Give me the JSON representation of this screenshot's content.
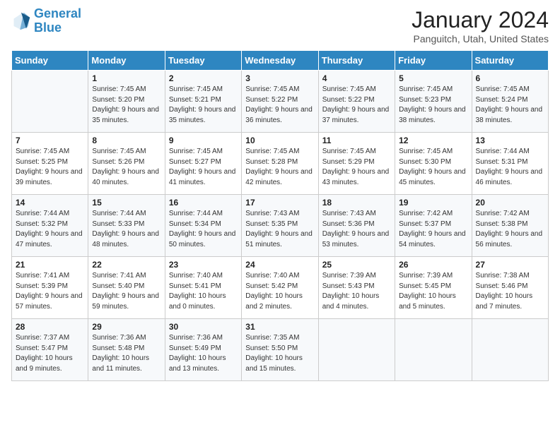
{
  "logo": {
    "line1": "General",
    "line2": "Blue"
  },
  "title": "January 2024",
  "subtitle": "Panguitch, Utah, United States",
  "weekdays": [
    "Sunday",
    "Monday",
    "Tuesday",
    "Wednesday",
    "Thursday",
    "Friday",
    "Saturday"
  ],
  "weeks": [
    [
      {
        "num": "",
        "sunrise": "",
        "sunset": "",
        "daylight": ""
      },
      {
        "num": "1",
        "sunrise": "Sunrise: 7:45 AM",
        "sunset": "Sunset: 5:20 PM",
        "daylight": "Daylight: 9 hours and 35 minutes."
      },
      {
        "num": "2",
        "sunrise": "Sunrise: 7:45 AM",
        "sunset": "Sunset: 5:21 PM",
        "daylight": "Daylight: 9 hours and 35 minutes."
      },
      {
        "num": "3",
        "sunrise": "Sunrise: 7:45 AM",
        "sunset": "Sunset: 5:22 PM",
        "daylight": "Daylight: 9 hours and 36 minutes."
      },
      {
        "num": "4",
        "sunrise": "Sunrise: 7:45 AM",
        "sunset": "Sunset: 5:22 PM",
        "daylight": "Daylight: 9 hours and 37 minutes."
      },
      {
        "num": "5",
        "sunrise": "Sunrise: 7:45 AM",
        "sunset": "Sunset: 5:23 PM",
        "daylight": "Daylight: 9 hours and 38 minutes."
      },
      {
        "num": "6",
        "sunrise": "Sunrise: 7:45 AM",
        "sunset": "Sunset: 5:24 PM",
        "daylight": "Daylight: 9 hours and 38 minutes."
      }
    ],
    [
      {
        "num": "7",
        "sunrise": "Sunrise: 7:45 AM",
        "sunset": "Sunset: 5:25 PM",
        "daylight": "Daylight: 9 hours and 39 minutes."
      },
      {
        "num": "8",
        "sunrise": "Sunrise: 7:45 AM",
        "sunset": "Sunset: 5:26 PM",
        "daylight": "Daylight: 9 hours and 40 minutes."
      },
      {
        "num": "9",
        "sunrise": "Sunrise: 7:45 AM",
        "sunset": "Sunset: 5:27 PM",
        "daylight": "Daylight: 9 hours and 41 minutes."
      },
      {
        "num": "10",
        "sunrise": "Sunrise: 7:45 AM",
        "sunset": "Sunset: 5:28 PM",
        "daylight": "Daylight: 9 hours and 42 minutes."
      },
      {
        "num": "11",
        "sunrise": "Sunrise: 7:45 AM",
        "sunset": "Sunset: 5:29 PM",
        "daylight": "Daylight: 9 hours and 43 minutes."
      },
      {
        "num": "12",
        "sunrise": "Sunrise: 7:45 AM",
        "sunset": "Sunset: 5:30 PM",
        "daylight": "Daylight: 9 hours and 45 minutes."
      },
      {
        "num": "13",
        "sunrise": "Sunrise: 7:44 AM",
        "sunset": "Sunset: 5:31 PM",
        "daylight": "Daylight: 9 hours and 46 minutes."
      }
    ],
    [
      {
        "num": "14",
        "sunrise": "Sunrise: 7:44 AM",
        "sunset": "Sunset: 5:32 PM",
        "daylight": "Daylight: 9 hours and 47 minutes."
      },
      {
        "num": "15",
        "sunrise": "Sunrise: 7:44 AM",
        "sunset": "Sunset: 5:33 PM",
        "daylight": "Daylight: 9 hours and 48 minutes."
      },
      {
        "num": "16",
        "sunrise": "Sunrise: 7:44 AM",
        "sunset": "Sunset: 5:34 PM",
        "daylight": "Daylight: 9 hours and 50 minutes."
      },
      {
        "num": "17",
        "sunrise": "Sunrise: 7:43 AM",
        "sunset": "Sunset: 5:35 PM",
        "daylight": "Daylight: 9 hours and 51 minutes."
      },
      {
        "num": "18",
        "sunrise": "Sunrise: 7:43 AM",
        "sunset": "Sunset: 5:36 PM",
        "daylight": "Daylight: 9 hours and 53 minutes."
      },
      {
        "num": "19",
        "sunrise": "Sunrise: 7:42 AM",
        "sunset": "Sunset: 5:37 PM",
        "daylight": "Daylight: 9 hours and 54 minutes."
      },
      {
        "num": "20",
        "sunrise": "Sunrise: 7:42 AM",
        "sunset": "Sunset: 5:38 PM",
        "daylight": "Daylight: 9 hours and 56 minutes."
      }
    ],
    [
      {
        "num": "21",
        "sunrise": "Sunrise: 7:41 AM",
        "sunset": "Sunset: 5:39 PM",
        "daylight": "Daylight: 9 hours and 57 minutes."
      },
      {
        "num": "22",
        "sunrise": "Sunrise: 7:41 AM",
        "sunset": "Sunset: 5:40 PM",
        "daylight": "Daylight: 9 hours and 59 minutes."
      },
      {
        "num": "23",
        "sunrise": "Sunrise: 7:40 AM",
        "sunset": "Sunset: 5:41 PM",
        "daylight": "Daylight: 10 hours and 0 minutes."
      },
      {
        "num": "24",
        "sunrise": "Sunrise: 7:40 AM",
        "sunset": "Sunset: 5:42 PM",
        "daylight": "Daylight: 10 hours and 2 minutes."
      },
      {
        "num": "25",
        "sunrise": "Sunrise: 7:39 AM",
        "sunset": "Sunset: 5:43 PM",
        "daylight": "Daylight: 10 hours and 4 minutes."
      },
      {
        "num": "26",
        "sunrise": "Sunrise: 7:39 AM",
        "sunset": "Sunset: 5:45 PM",
        "daylight": "Daylight: 10 hours and 5 minutes."
      },
      {
        "num": "27",
        "sunrise": "Sunrise: 7:38 AM",
        "sunset": "Sunset: 5:46 PM",
        "daylight": "Daylight: 10 hours and 7 minutes."
      }
    ],
    [
      {
        "num": "28",
        "sunrise": "Sunrise: 7:37 AM",
        "sunset": "Sunset: 5:47 PM",
        "daylight": "Daylight: 10 hours and 9 minutes."
      },
      {
        "num": "29",
        "sunrise": "Sunrise: 7:36 AM",
        "sunset": "Sunset: 5:48 PM",
        "daylight": "Daylight: 10 hours and 11 minutes."
      },
      {
        "num": "30",
        "sunrise": "Sunrise: 7:36 AM",
        "sunset": "Sunset: 5:49 PM",
        "daylight": "Daylight: 10 hours and 13 minutes."
      },
      {
        "num": "31",
        "sunrise": "Sunrise: 7:35 AM",
        "sunset": "Sunset: 5:50 PM",
        "daylight": "Daylight: 10 hours and 15 minutes."
      },
      {
        "num": "",
        "sunrise": "",
        "sunset": "",
        "daylight": ""
      },
      {
        "num": "",
        "sunrise": "",
        "sunset": "",
        "daylight": ""
      },
      {
        "num": "",
        "sunrise": "",
        "sunset": "",
        "daylight": ""
      }
    ]
  ]
}
